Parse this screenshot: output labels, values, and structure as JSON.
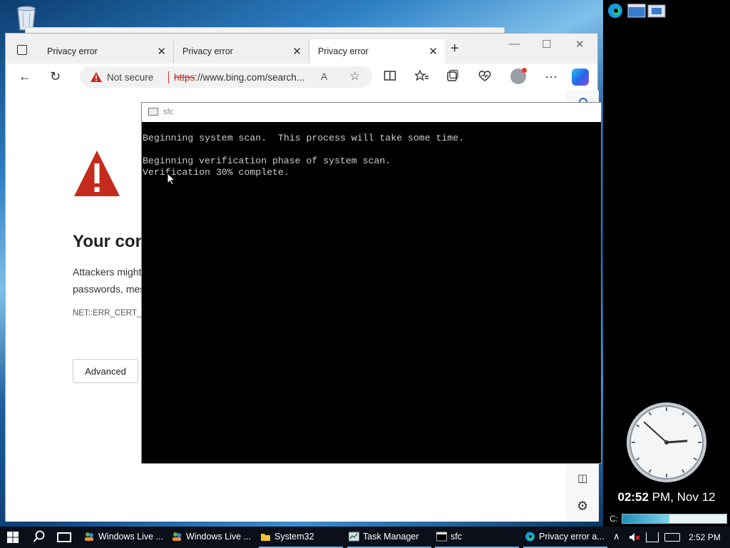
{
  "browser": {
    "tabs": [
      {
        "label": "Privacy error",
        "close": "✕"
      },
      {
        "label": "Privacy error",
        "close": "✕"
      },
      {
        "label": "Privacy error",
        "close": "✕"
      }
    ],
    "new_tab_symbol": "+",
    "window_controls": {
      "minimize": "—",
      "maximize": "☐",
      "close": "✕"
    },
    "toolbar": {
      "back": "←",
      "refresh": "↻",
      "security_label": "Not secure",
      "url_scheme": "https",
      "url_rest": "://www.bing.com/search...",
      "read_aloud": "A",
      "favorite": "☆",
      "more": "···"
    },
    "error_page": {
      "title": "Your con",
      "body_line_1": "Attackers might",
      "body_line_2": "passwords, mes",
      "error_code": "NET::ERR_CERT_AU",
      "advanced_button": "Advanced"
    },
    "accent_color": "#c42b1c"
  },
  "console": {
    "title": "sfc",
    "lines": [
      "Beginning system scan.  This process will take some time.",
      "",
      "Beginning verification phase of system scan.",
      "Verification 30% complete."
    ]
  },
  "sidebar": {
    "clock_time_bold": "02:52",
    "clock_time_rest": " PM, Nov 12",
    "clock_hands": {
      "hour": 2,
      "minute": 52
    },
    "drive_label": "C:",
    "drive_used_fraction": 0.45
  },
  "taskbar": {
    "tasks": [
      {
        "label": "Windows Live ...",
        "icon": "people-icon"
      },
      {
        "label": "Windows Live ...",
        "icon": "people-icon"
      },
      {
        "label": "System32",
        "icon": "folder-icon"
      },
      {
        "label": "Task Manager",
        "icon": "task-manager-icon"
      },
      {
        "label": "sfc",
        "icon": "console-icon"
      },
      {
        "label": "Privacy error a...",
        "icon": "edge-icon"
      }
    ],
    "tray_time": "2:52 PM"
  }
}
